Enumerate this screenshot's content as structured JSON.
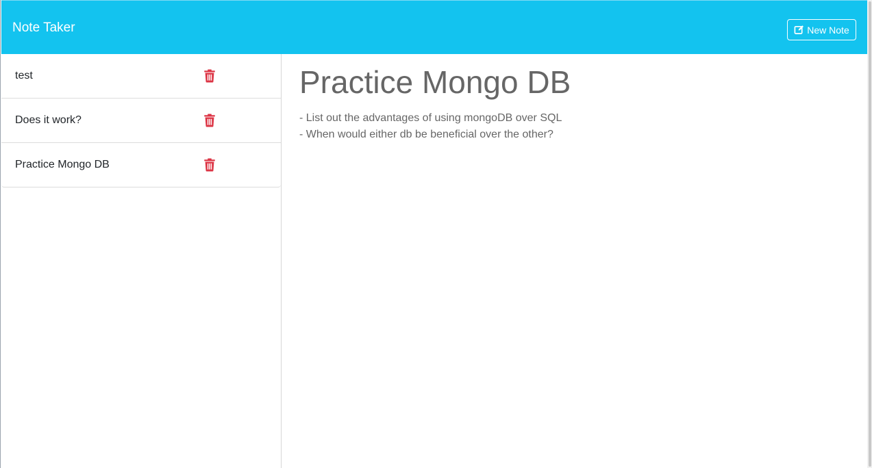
{
  "app": {
    "title": "Note Taker",
    "new_note_label": "New Note",
    "accent_color": "#13c3ef",
    "delete_icon_color": "#dc3545"
  },
  "notes": [
    {
      "title": "test",
      "delete_icon": "trash-icon"
    },
    {
      "title": "Does it work?",
      "delete_icon": "trash-icon"
    },
    {
      "title": "Practice Mongo DB",
      "delete_icon": "trash-icon"
    }
  ],
  "active_note": {
    "title": "Practice Mongo DB",
    "text": "- List out the advantages of using mongoDB over SQL\n- When would either db be beneficial over the other?"
  }
}
